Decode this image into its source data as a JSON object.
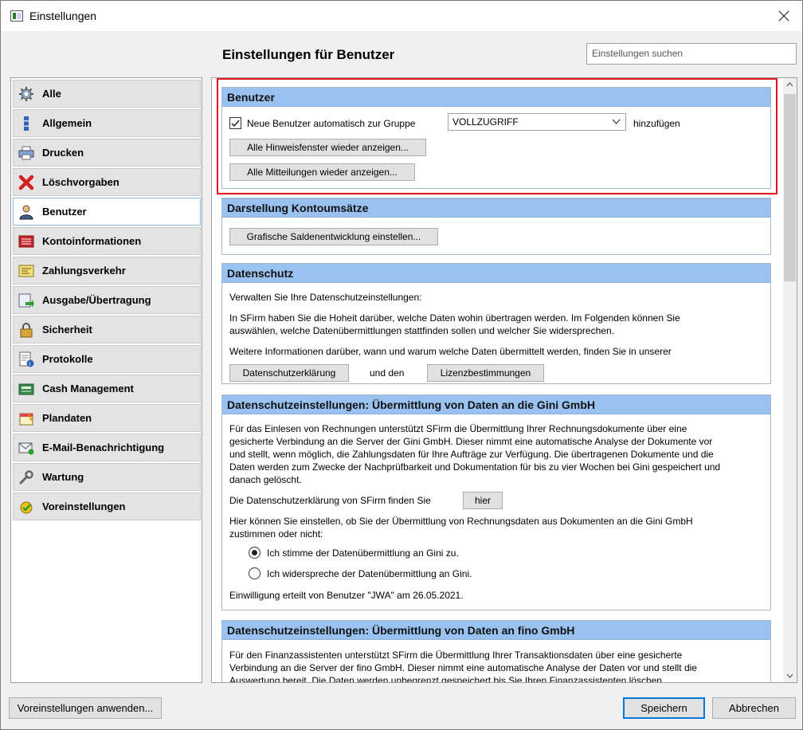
{
  "window": {
    "title": "Einstellungen"
  },
  "header": {
    "title": "Einstellungen für Benutzer",
    "search_placeholder": "Einstellungen suchen"
  },
  "sidebar": {
    "items": [
      {
        "label": "Alle",
        "icon": "gear-icon",
        "active": false
      },
      {
        "label": "Allgemein",
        "icon": "dots-icon",
        "active": false
      },
      {
        "label": "Drucken",
        "icon": "printer-icon",
        "active": false
      },
      {
        "label": "Löschvorgaben",
        "icon": "red-x-icon",
        "active": false
      },
      {
        "label": "Benutzer",
        "icon": "user-icon",
        "active": true
      },
      {
        "label": "Kontoinformationen",
        "icon": "account-book-icon",
        "active": false
      },
      {
        "label": "Zahlungsverkehr",
        "icon": "payment-form-icon",
        "active": false
      },
      {
        "label": "Ausgabe/Übertragung",
        "icon": "transfer-icon",
        "active": false
      },
      {
        "label": "Sicherheit",
        "icon": "lock-icon",
        "active": false
      },
      {
        "label": "Protokolle",
        "icon": "log-document-icon",
        "active": false
      },
      {
        "label": "Cash Management",
        "icon": "cash-register-icon",
        "active": false
      },
      {
        "label": "Plandaten",
        "icon": "plan-data-icon",
        "active": false
      },
      {
        "label": "E-Mail-Benachrichtigung",
        "icon": "email-icon",
        "active": false
      },
      {
        "label": "Wartung",
        "icon": "wrench-icon",
        "active": false
      },
      {
        "label": "Voreinstellungen",
        "icon": "preset-icon",
        "active": false
      }
    ]
  },
  "benutzer": {
    "title": "Benutzer",
    "auto_group_label": "Neue Benutzer automatisch zur Gruppe",
    "auto_group_checked": true,
    "group_value": "VOLLZUGRIFF",
    "suffix": "hinzufügen",
    "btn_hints": "Alle Hinweisfenster wieder anzeigen...",
    "btn_messages": "Alle Mitteilungen wieder anzeigen..."
  },
  "darstellung": {
    "title": "Darstellung Kontoumsätze",
    "btn_chart": "Grafische Saldenentwicklung einstellen..."
  },
  "datenschutz": {
    "title": "Datenschutz",
    "line1": "Verwalten Sie Ihre Datenschutzeinstellungen:",
    "line2a": "In SFirm haben Sie die Hoheit darüber, welche Daten wohin übertragen werden. Im Folgenden können Sie",
    "line2b": "auswählen, welche Datenübermittlungen stattfinden sollen und welcher Sie widersprechen.",
    "line3": "Weitere Informationen darüber, wann und warum welche Daten übermittelt werden, finden Sie in unserer",
    "btn_privacy": "Datenschutzerklärung",
    "and_text": "und den",
    "btn_license": "Lizenzbestimmungen"
  },
  "gini": {
    "title": "Datenschutzeinstellungen: Übermittlung von Daten an die Gini GmbH",
    "p1": [
      "Für das Einlesen von Rechnungen unterstützt SFirm die Übermittlung Ihrer Rechnungsdokumente über eine",
      "gesicherte Verbindung an die Server der Gini GmbH. Dieser nimmt eine automatische Analyse der Dokumente vor",
      "und stellt, wenn möglich, die Zahlungsdaten für Ihre Aufträge zur Verfügung. Die übertragenen Dokumente und die",
      "Daten werden zum Zwecke der Nachprüfbarkeit und Dokumentation für bis zu vier Wochen bei Gini gespeichert und",
      "danach gelöscht."
    ],
    "privacy_line": "Die Datenschutzerklärung von SFirm finden Sie",
    "btn_here": "hier",
    "consent_q1": "Hier können Sie einstellen, ob Sie der Übermittlung von Rechnungsdaten aus Dokumenten an die Gini GmbH",
    "consent_q2": "zustimmen oder nicht:",
    "radio_agree": "Ich stimme der Datenübermittlung an Gini zu.",
    "radio_disagree": "Ich widerspreche der Datenübermittlung an Gini.",
    "selected": "agree",
    "consent_info": "Einwilligung erteilt von Benutzer \"JWA\" am 26.05.2021."
  },
  "fino": {
    "title": "Datenschutzeinstellungen: Übermittlung von Daten an fino GmbH",
    "p1": [
      "Für den Finanzassistenten unterstützt SFirm die Übermittlung Ihrer Transaktionsdaten über eine gesicherte",
      "Verbindung an die Server der fino GmbH. Dieser nimmt eine automatische Analyse der Daten vor und stellt die",
      "Auswertung bereit. Die Daten werden unbegrenzt gespeichert bis Sie Ihren Finanzassistenten löschen."
    ]
  },
  "footer": {
    "apply_defaults": "Voreinstellungen anwenden...",
    "save": "Speichern",
    "cancel": "Abbrechen"
  },
  "colors": {
    "section_header": "#99c2f0",
    "highlight": "#e0141e",
    "accent": "#0078d7"
  }
}
